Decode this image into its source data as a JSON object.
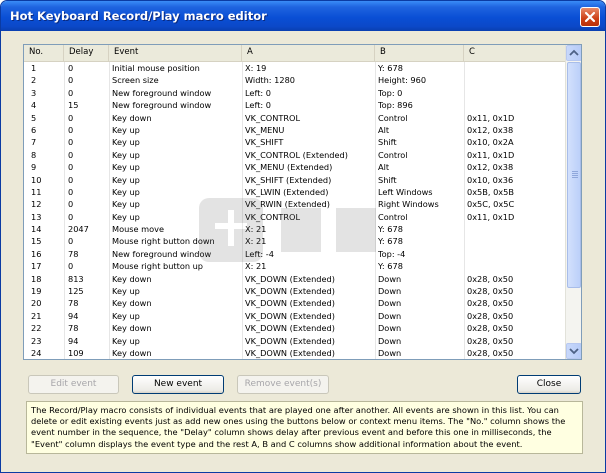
{
  "window": {
    "title": "Hot Keyboard Record/Play macro editor"
  },
  "table": {
    "columns": [
      "No.",
      "Delay",
      "Event",
      "A",
      "B",
      "C"
    ],
    "rows": [
      {
        "no": "1",
        "delay": "0",
        "event": "Initial mouse position",
        "a": "X: 19",
        "b": "Y: 678",
        "c": ""
      },
      {
        "no": "2",
        "delay": "0",
        "event": "Screen size",
        "a": "Width: 1280",
        "b": "Height: 960",
        "c": ""
      },
      {
        "no": "3",
        "delay": "0",
        "event": "New foreground window",
        "a": "Left: 0",
        "b": "Top: 0",
        "c": ""
      },
      {
        "no": "4",
        "delay": "15",
        "event": "New foreground window",
        "a": "Left: 0",
        "b": "Top: 896",
        "c": ""
      },
      {
        "no": "5",
        "delay": "0",
        "event": "Key down",
        "a": "VK_CONTROL",
        "b": "Control",
        "c": "0x11, 0x1D"
      },
      {
        "no": "6",
        "delay": "0",
        "event": "Key up",
        "a": "VK_MENU",
        "b": "Alt",
        "c": "0x12, 0x38"
      },
      {
        "no": "7",
        "delay": "0",
        "event": "Key up",
        "a": "VK_SHIFT",
        "b": "Shift",
        "c": "0x10, 0x2A"
      },
      {
        "no": "8",
        "delay": "0",
        "event": "Key up",
        "a": "VK_CONTROL (Extended)",
        "b": "Control",
        "c": "0x11, 0x1D"
      },
      {
        "no": "9",
        "delay": "0",
        "event": "Key up",
        "a": "VK_MENU (Extended)",
        "b": "Alt",
        "c": "0x12, 0x38"
      },
      {
        "no": "10",
        "delay": "0",
        "event": "Key up",
        "a": "VK_SHIFT (Extended)",
        "b": "Shift",
        "c": "0x10, 0x36"
      },
      {
        "no": "11",
        "delay": "0",
        "event": "Key up",
        "a": "VK_LWIN (Extended)",
        "b": "Left Windows",
        "c": "0x5B, 0x5B"
      },
      {
        "no": "12",
        "delay": "0",
        "event": "Key up",
        "a": "VK_RWIN (Extended)",
        "b": "Right Windows",
        "c": "0x5C, 0x5C"
      },
      {
        "no": "13",
        "delay": "0",
        "event": "Key up",
        "a": "VK_CONTROL",
        "b": "Control",
        "c": "0x11, 0x1D"
      },
      {
        "no": "14",
        "delay": "2047",
        "event": "Mouse move",
        "a": "X: 21",
        "b": "Y: 678",
        "c": ""
      },
      {
        "no": "15",
        "delay": "0",
        "event": "Mouse right button down",
        "a": "X: 21",
        "b": "Y: 678",
        "c": ""
      },
      {
        "no": "16",
        "delay": "78",
        "event": "New foreground window",
        "a": "Left: -4",
        "b": "Top: -4",
        "c": ""
      },
      {
        "no": "17",
        "delay": "0",
        "event": "Mouse right button up",
        "a": "X: 21",
        "b": "Y: 678",
        "c": ""
      },
      {
        "no": "18",
        "delay": "813",
        "event": "Key down",
        "a": "VK_DOWN (Extended)",
        "b": "Down",
        "c": "0x28, 0x50"
      },
      {
        "no": "19",
        "delay": "125",
        "event": "Key up",
        "a": "VK_DOWN (Extended)",
        "b": "Down",
        "c": "0x28, 0x50"
      },
      {
        "no": "20",
        "delay": "78",
        "event": "Key down",
        "a": "VK_DOWN (Extended)",
        "b": "Down",
        "c": "0x28, 0x50"
      },
      {
        "no": "21",
        "delay": "94",
        "event": "Key up",
        "a": "VK_DOWN (Extended)",
        "b": "Down",
        "c": "0x28, 0x50"
      },
      {
        "no": "22",
        "delay": "78",
        "event": "Key down",
        "a": "VK_DOWN (Extended)",
        "b": "Down",
        "c": "0x28, 0x50"
      },
      {
        "no": "23",
        "delay": "94",
        "event": "Key up",
        "a": "VK_DOWN (Extended)",
        "b": "Down",
        "c": "0x28, 0x50"
      },
      {
        "no": "24",
        "delay": "109",
        "event": "Key down",
        "a": "VK_DOWN (Extended)",
        "b": "Down",
        "c": "0x28, 0x50"
      }
    ]
  },
  "buttons": {
    "edit_event": "Edit event",
    "new_event": "New event",
    "remove_events": "Remove event(s)",
    "close": "Close"
  },
  "info_text": "The Record/Play macro consists of individual events that are played one after another. All events are shown in this list. You can delete or edit existing events just as add new ones using the buttons below or context menu items. The \"No.\" column shows the event number in the sequence, the \"Delay\" column shows delay after previous event and before this one in milliseconds, the \"Event\" column displays the event type and the rest A, B and C columns show additional information about the event.",
  "icons": {
    "close": "close-icon",
    "scroll_up": "arrow-up-icon",
    "scroll_down": "arrow-down-icon"
  },
  "colors": {
    "titlebar": "#0a4fd5",
    "frame": "#ece9d8",
    "info_bg": "#ffffe1"
  }
}
